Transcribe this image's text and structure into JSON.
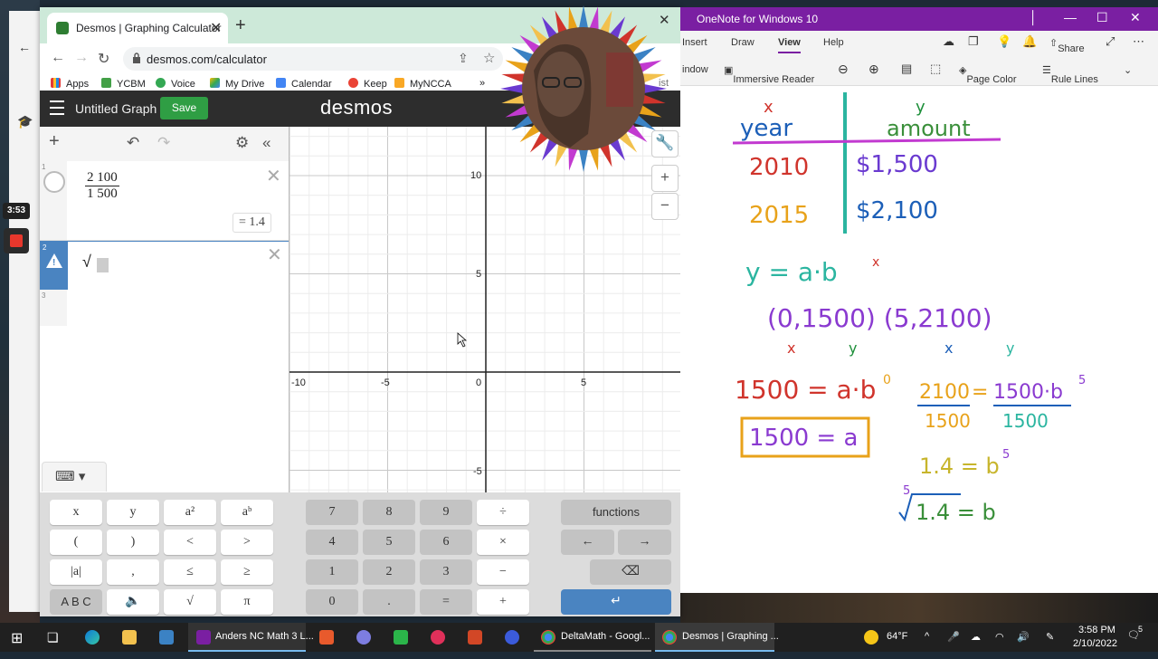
{
  "browser": {
    "tab_title": "Desmos | Graphing Calculator",
    "url": "desmos.com/calculator",
    "bookmarks": [
      "Apps",
      "YCBM",
      "Voice",
      "My Drive",
      "Calendar",
      "Keep",
      "MyNCCA"
    ],
    "bookmark_overflow": "»",
    "partial_right_text": "ist"
  },
  "desmos": {
    "graph_title": "Untitled Graph",
    "save_label": "Save",
    "logo": "desmos",
    "expressions": [
      {
        "index": "1",
        "numerator": "2 100",
        "denominator": "1 500",
        "result": "= 1.4"
      },
      {
        "index": "2",
        "content": "√",
        "warning": "!"
      },
      {
        "index": "3"
      }
    ],
    "axis_labels": {
      "x": [
        "-10",
        "-5",
        "0",
        "5"
      ],
      "y": [
        "10",
        "5",
        "-5"
      ]
    },
    "keypad": {
      "left": [
        [
          "x",
          "y",
          "a²",
          "aᵇ"
        ],
        [
          "(",
          ")",
          "<",
          ">"
        ],
        [
          "|a|",
          ",",
          "≤",
          "≥"
        ],
        [
          "A B C",
          "🔈",
          "√",
          "π"
        ]
      ],
      "mid": [
        [
          "7",
          "8",
          "9",
          "÷"
        ],
        [
          "4",
          "5",
          "6",
          "×"
        ],
        [
          "1",
          "2",
          "3",
          "−"
        ],
        [
          "0",
          ".",
          "=",
          "+"
        ]
      ],
      "functions_label": "functions",
      "left_arrow": "←",
      "right_arrow": "→",
      "backspace": "⌫",
      "enter": "↵"
    }
  },
  "onenote": {
    "window_title": "OneNote for Windows 10",
    "menu": [
      "Insert",
      "Draw",
      "View",
      "Help"
    ],
    "share_label": "Share",
    "ribbon": [
      "indow",
      "Immersive Reader",
      "Page Color",
      "Rule Lines"
    ],
    "notes": {
      "x_head": "x",
      "y_head": "y",
      "col1": "year",
      "col2": "amount",
      "r1a": "2010",
      "r1b": "$1,500",
      "r2a": "2015",
      "r2b": "$2,100",
      "eq1": "y = a·b",
      "eq1_exp": "x",
      "pts": "(0,1500) (5,2100)",
      "eq2": "1500 = a·b",
      "eq2_exp": "0",
      "boxed": "1500 = a",
      "rhs_num": "2100",
      "rhs_mid": " = ",
      "rhs_num2": "1500·b",
      "rhs_exp": "5",
      "rhs_den": "1500",
      "rhs_den2": "1500",
      "eq3": "1.4 = b",
      "eq3_exp": "5",
      "root_index": "5",
      "root_body": "1.4 = b"
    }
  },
  "recorder": {
    "time": "3:53"
  },
  "taskbar": {
    "items": [
      "Anders NC Math 3 L...",
      "DeltaMath - Googl...",
      "Desmos | Graphing ..."
    ],
    "weather": "64°F",
    "time": "3:58 PM",
    "date": "2/10/2022",
    "notif_count": "5"
  }
}
